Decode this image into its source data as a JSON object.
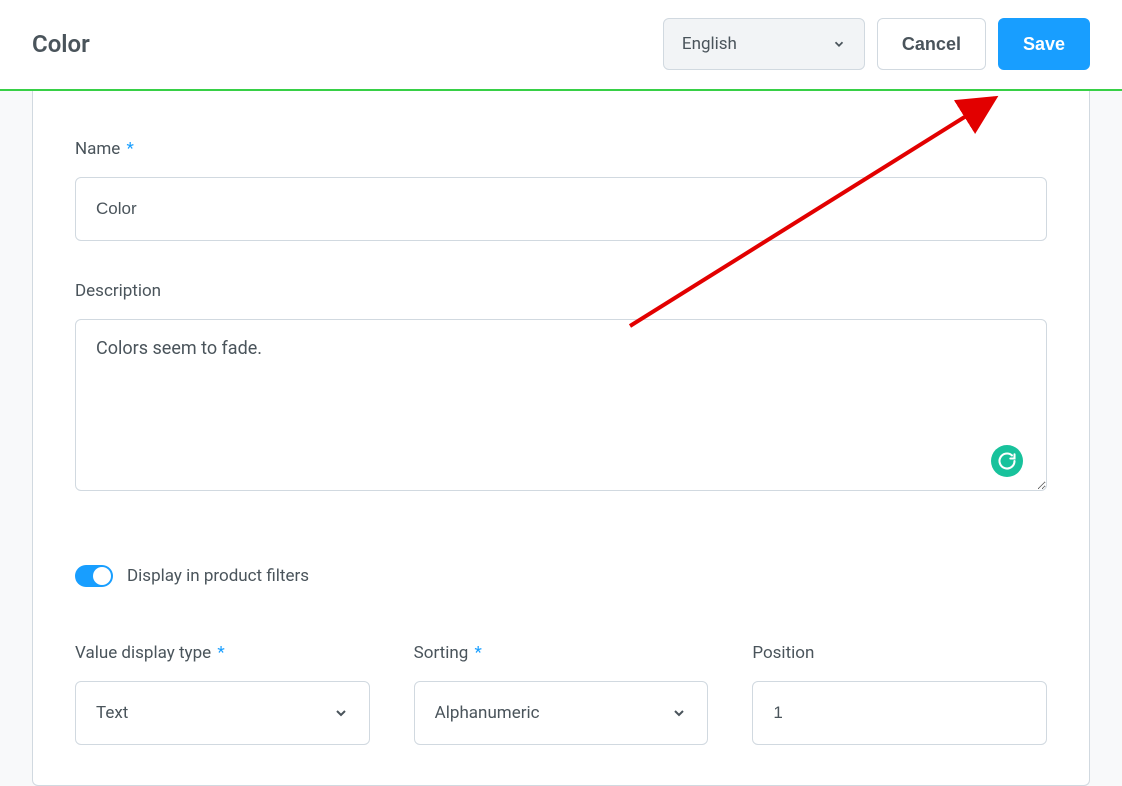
{
  "header": {
    "title": "Color",
    "languageSelect": {
      "value": "English"
    },
    "cancelLabel": "Cancel",
    "saveLabel": "Save"
  },
  "form": {
    "name": {
      "label": "Name",
      "value": "Color"
    },
    "description": {
      "label": "Description",
      "value": "Colors seem to fade."
    },
    "displayInFilters": {
      "label": "Display in product filters",
      "on": true
    },
    "valueDisplayType": {
      "label": "Value display type",
      "value": "Text"
    },
    "sorting": {
      "label": "Sorting",
      "value": "Alphanumeric"
    },
    "position": {
      "label": "Position",
      "value": "1"
    }
  },
  "requiredMark": "*"
}
